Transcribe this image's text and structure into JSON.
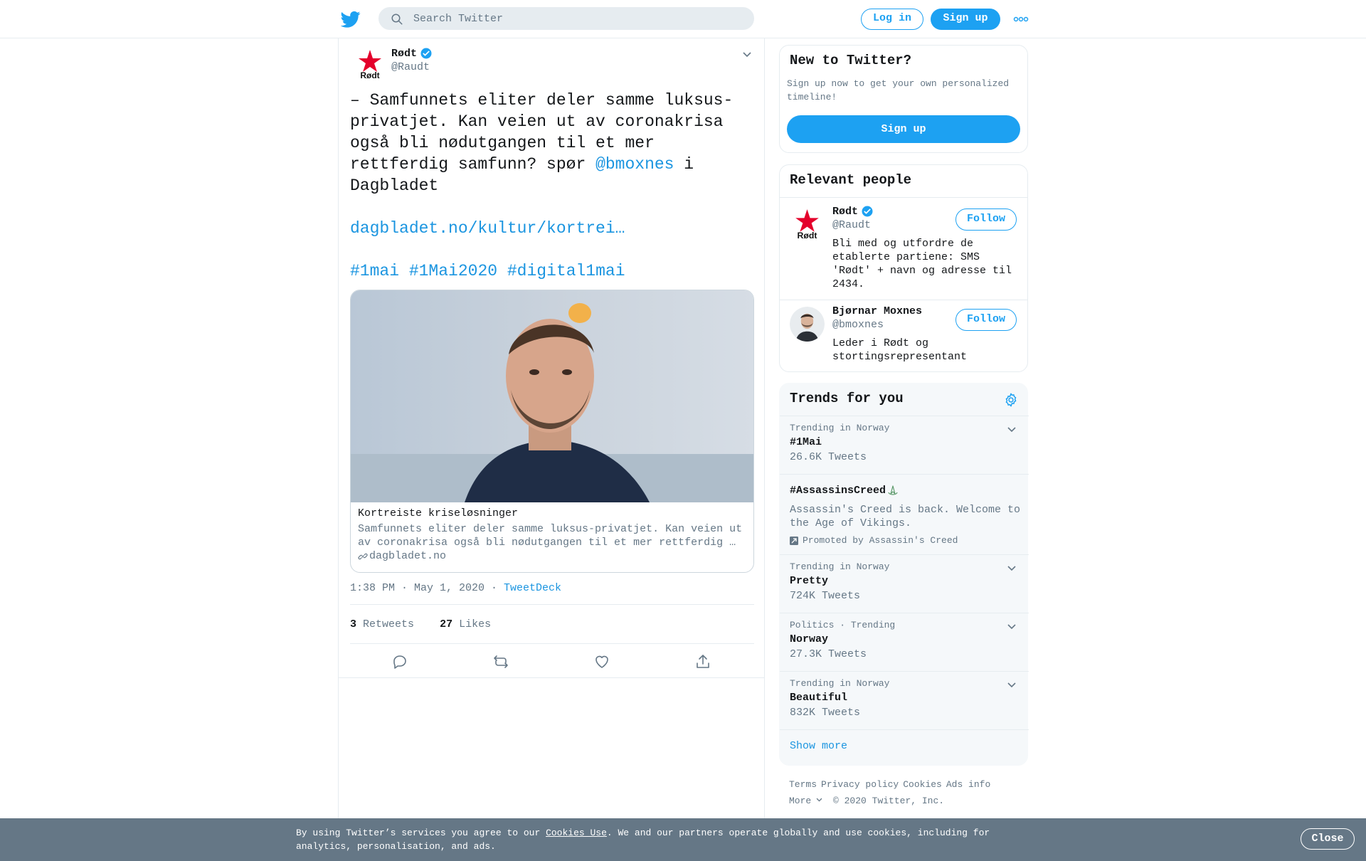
{
  "header": {
    "logo_icon": "twitter-bird-icon",
    "search_placeholder": "Search Twitter",
    "login_label": "Log in",
    "signup_label": "Sign up",
    "more_icon": "more-dots-icon"
  },
  "tweet": {
    "author_name": "Rødt",
    "author_handle": "@Raudt",
    "verified_icon": "verified-badge-icon",
    "text_part1": "– Samfunnets eliter deler samme luksus-privatjet. Kan veien ut av coronakrisa også bli nødutgangen til et mer rettferdig samfunn? spør ",
    "mention": "@bmoxnes",
    "text_part2": " i Dagbladet",
    "link": "dagbladet.no/kultur/kortrei…",
    "hashtags": [
      "#1mai",
      "#1Mai2020",
      "#digital1mai"
    ],
    "card": {
      "title": "Kortreiste kriseløsninger",
      "description": "Samfunnets eliter deler samme luksus-privatjet. Kan veien ut av coronakrisa også bli nødutgangen til et mer rettferdig …",
      "domain": "dagbladet.no"
    },
    "time": "1:38 PM · May 1, 2020",
    "source": "TweetDeck",
    "retweets_count": "3",
    "retweets_label": "Retweets",
    "likes_count": "27",
    "likes_label": "Likes"
  },
  "new_to_twitter": {
    "title": "New to Twitter?",
    "description": "Sign up now to get your own personalized timeline!",
    "signup_label": "Sign up"
  },
  "relevant_people": {
    "title": "Relevant people",
    "people": [
      {
        "name": "Rødt",
        "handle": "@Raudt",
        "bio": "Bli med og utfordre de etablerte partiene: SMS 'Rødt' + navn og adresse til 2434.",
        "follow_label": "Follow"
      },
      {
        "name": "Bjørnar Moxnes",
        "handle": "@bmoxnes",
        "bio": "Leder i Rødt og stortingsrepresentant",
        "follow_label": "Follow"
      }
    ]
  },
  "trends": {
    "title": "Trends for you",
    "items": [
      {
        "context": "Trending in Norway",
        "name": "#1Mai",
        "count": "26.6K Tweets"
      },
      {
        "name": "#AssassinsCreed",
        "description": "Assassin's Creed is back. Welcome to the Age of Vikings.",
        "promoted_by": "Promoted by Assassin's Creed"
      },
      {
        "context": "Trending in Norway",
        "name": "Pretty",
        "count": "724K Tweets"
      },
      {
        "context": "Politics · Trending",
        "name": "Norway",
        "count": "27.3K Tweets"
      },
      {
        "context": "Trending in Norway",
        "name": "Beautiful",
        "count": "832K Tweets"
      }
    ],
    "show_more": "Show more"
  },
  "footer": {
    "links": [
      "Terms",
      "Privacy policy",
      "Cookies",
      "Ads info"
    ],
    "more": "More",
    "copyright": "© 2020 Twitter, Inc."
  },
  "cookie_bar": {
    "text_before": "By using Twitter’s services you agree to our ",
    "link": "Cookies Use",
    "text_after": ". We and our partners operate globally and use cookies, including for analytics, personalisation, and ads.",
    "close_label": "Close"
  },
  "colors": {
    "brand_blue": "#1da1f2",
    "link_blue": "#1b95e0",
    "secondary_text": "#657786",
    "border": "#e6ecf0"
  }
}
